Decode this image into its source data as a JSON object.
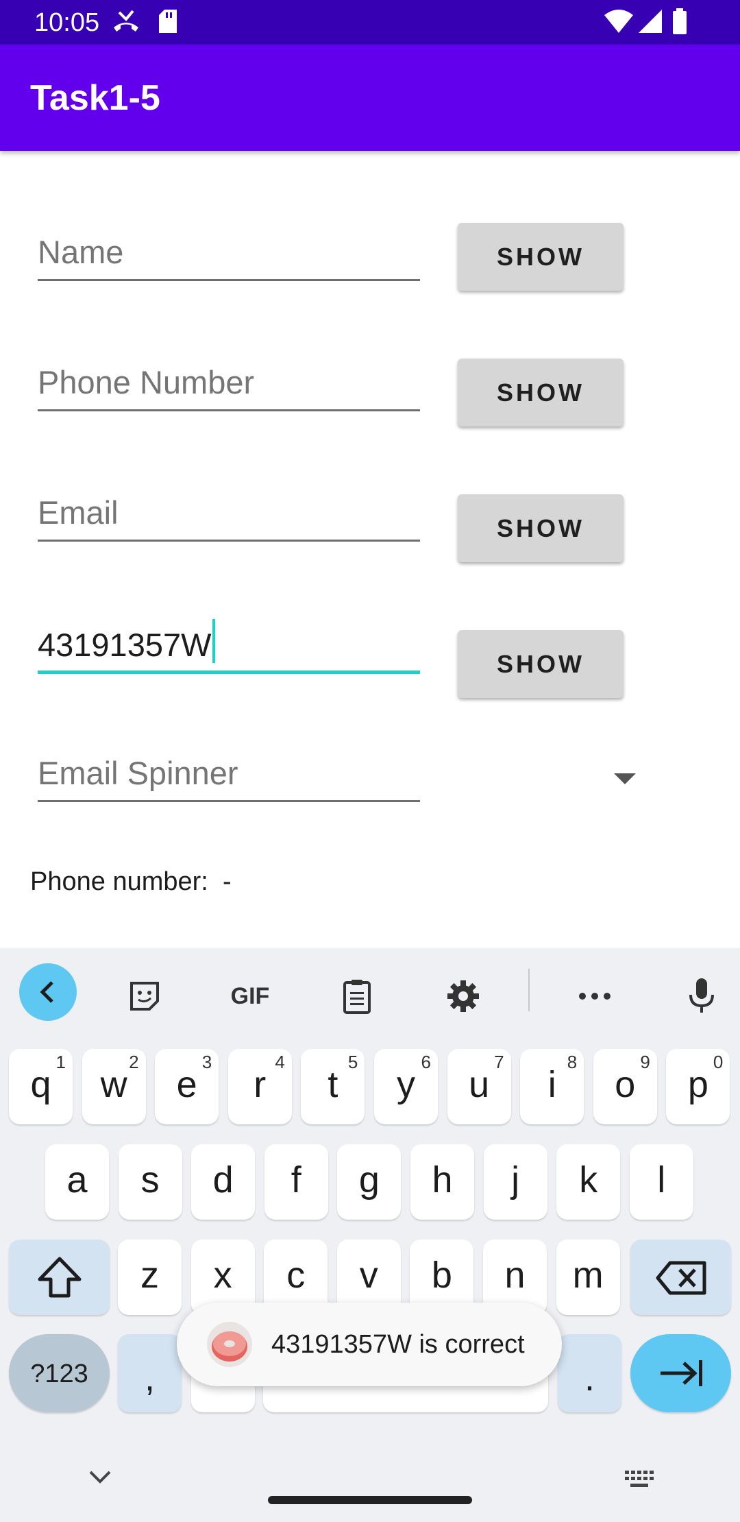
{
  "status_bar": {
    "time": "10:05",
    "left_icons": [
      "missed-call-icon",
      "sd-card-icon"
    ],
    "right_icons": [
      "wifi-icon",
      "signal-icon",
      "battery-icon"
    ]
  },
  "app_bar": {
    "title": "Task1-5"
  },
  "form": {
    "name_placeholder": "Name",
    "phone_placeholder": "Phone Number",
    "email_placeholder": "Email",
    "id_value": "43191357W",
    "spinner_placeholder": "Email Spinner",
    "show_label": "SHOW",
    "phone_result": "Phone number:  -"
  },
  "keyboard": {
    "toolbar_icons": [
      "back-icon",
      "sticker-icon",
      "gif-icon",
      "clipboard-icon",
      "settings-icon",
      "more-icon",
      "mic-icon"
    ],
    "gif_label": "GIF",
    "row1": [
      {
        "k": "q",
        "s": "1"
      },
      {
        "k": "w",
        "s": "2"
      },
      {
        "k": "e",
        "s": "3"
      },
      {
        "k": "r",
        "s": "4"
      },
      {
        "k": "t",
        "s": "5"
      },
      {
        "k": "y",
        "s": "6"
      },
      {
        "k": "u",
        "s": "7"
      },
      {
        "k": "i",
        "s": "8"
      },
      {
        "k": "o",
        "s": "9"
      },
      {
        "k": "p",
        "s": "0"
      }
    ],
    "row2": [
      "a",
      "s",
      "d",
      "f",
      "g",
      "h",
      "j",
      "k",
      "l"
    ],
    "row3": [
      "z",
      "x",
      "c",
      "v",
      "b",
      "n",
      "m"
    ],
    "num_label": "?123",
    "comma": ",",
    "period": ".",
    "accent": "#5ec8f3"
  },
  "toast": {
    "message": "43191357W is correct"
  },
  "colors": {
    "status_bar": "#3700b3",
    "app_bar": "#6200ee",
    "focus_underline": "#1ad3c4"
  }
}
